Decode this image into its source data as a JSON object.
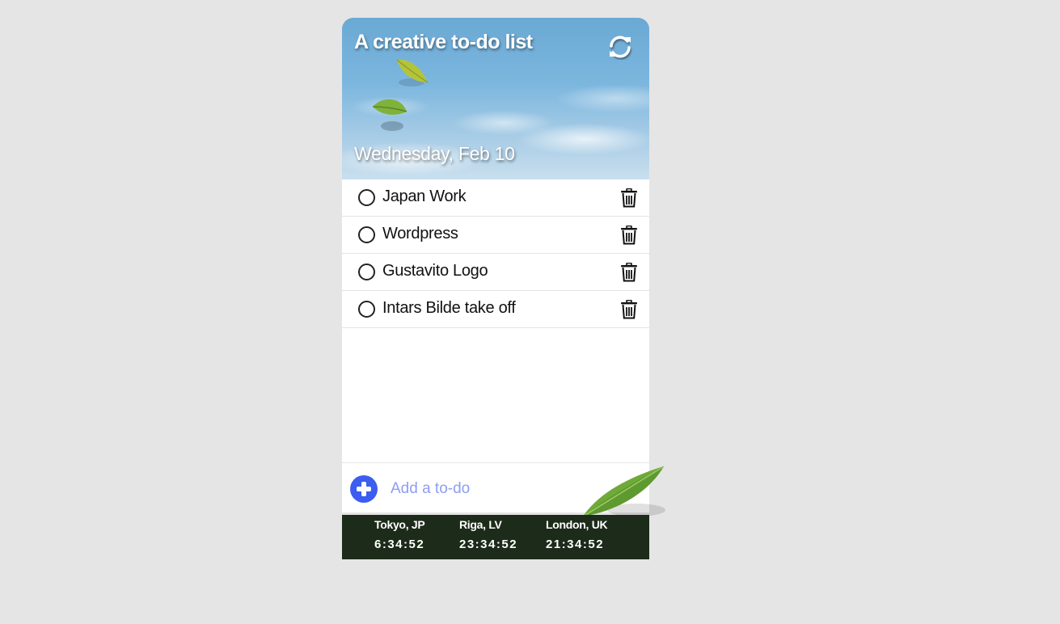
{
  "header": {
    "title": "A creative to-do list",
    "date": "Wednesday, Feb 10",
    "refresh_icon": "refresh-icon"
  },
  "todos": [
    {
      "label": "Japan Work",
      "done": false
    },
    {
      "label": "Wordpress",
      "done": false
    },
    {
      "label": "Gustavito Logo",
      "done": false
    },
    {
      "label": "Intars Bilde take off",
      "done": false
    }
  ],
  "add": {
    "placeholder": "Add a to-do",
    "icon": "plus-icon"
  },
  "clocks": [
    {
      "city": "Tokyo, JP",
      "time": "6:34:52"
    },
    {
      "city": "Riga, LV",
      "time": "23:34:52"
    },
    {
      "city": "London, UK",
      "time": "21:34:52"
    }
  ],
  "colors": {
    "accent": "#3d5cf0",
    "placeholder": "#8d9ef2",
    "clock_bar": "#1d2b1a",
    "background": "#e5e5e5"
  }
}
